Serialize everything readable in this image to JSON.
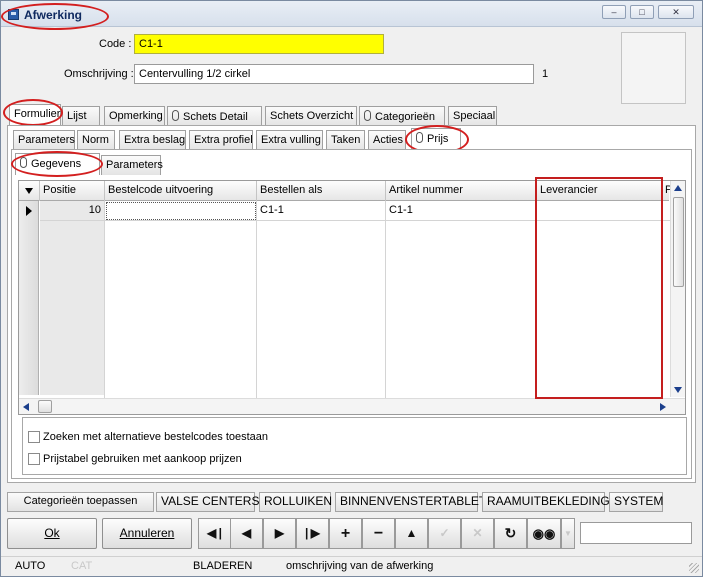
{
  "window": {
    "title": "Afwerking",
    "controls": [
      "minimize-icon",
      "maximize-icon",
      "close-icon"
    ]
  },
  "form": {
    "code_label": "Code :",
    "code_value": "C1-1",
    "omschrijving_label": "Omschrijving :",
    "omschrijving_value": "Centervulling 1/2 cirkel",
    "counter": "1"
  },
  "main_tabs": [
    {
      "label": "Formulier",
      "active": true
    },
    {
      "label": "Lijst"
    },
    {
      "label": "Opmerking"
    },
    {
      "label": "Schets Detail",
      "icon": "paperclip-icon"
    },
    {
      "label": "Schets Overzicht"
    },
    {
      "label": "Categorieën",
      "icon": "paperclip-icon"
    },
    {
      "label": "Speciaal"
    }
  ],
  "sub_tabs": [
    {
      "label": "Parameters"
    },
    {
      "label": "Norm"
    },
    {
      "label": "Extra beslag"
    },
    {
      "label": "Extra profiel"
    },
    {
      "label": "Extra vulling"
    },
    {
      "label": "Taken"
    },
    {
      "label": "Acties"
    },
    {
      "label": "Prijs",
      "icon": "paperclip-icon",
      "active": true
    }
  ],
  "price_tabs": [
    {
      "label": "Gegevens",
      "icon": "paperclip-icon",
      "active": true
    },
    {
      "label": "Parameters"
    }
  ],
  "grid": {
    "columns": [
      "Positie",
      "Bestelcode uitvoering",
      "Bestellen als",
      "Artikel nummer",
      "Leverancier",
      "P"
    ],
    "rows": [
      {
        "positie": "10",
        "bestelcode": "",
        "bestellen_als": "C1-1",
        "artikel": "C1-1",
        "leverancier": ""
      }
    ]
  },
  "options": {
    "alt_codes": {
      "label": "Zoeken met alternatieve bestelcodes toestaan",
      "checked": false
    },
    "price_table": {
      "label": "Prijstabel gebruiken met aankoop prijzen",
      "checked": false
    }
  },
  "category_bar": {
    "apply_label": "Categorieën toepassen",
    "items": [
      "VALSE CENTERS",
      "ROLLUIKEN",
      "BINNENVENSTERTABLET",
      "RAAMUITBEKLEDING",
      "SYSTEM"
    ]
  },
  "buttons": {
    "ok": "Ok",
    "cancel": "Annuleren"
  },
  "nav_icons": [
    "first-icon",
    "prev-icon",
    "next-icon",
    "last-icon",
    "add-icon",
    "delete-icon",
    "up-icon",
    "confirm-icon",
    "discard-icon",
    "refresh-icon",
    "binoculars-icon"
  ],
  "search_value": "",
  "status": {
    "mode": "AUTO",
    "cat": "CAT",
    "state": "BLADEREN",
    "hint": "omschrijving van de afwerking"
  },
  "colors": {
    "highlight": "#ffff00",
    "annotation": "#d31f1f"
  }
}
